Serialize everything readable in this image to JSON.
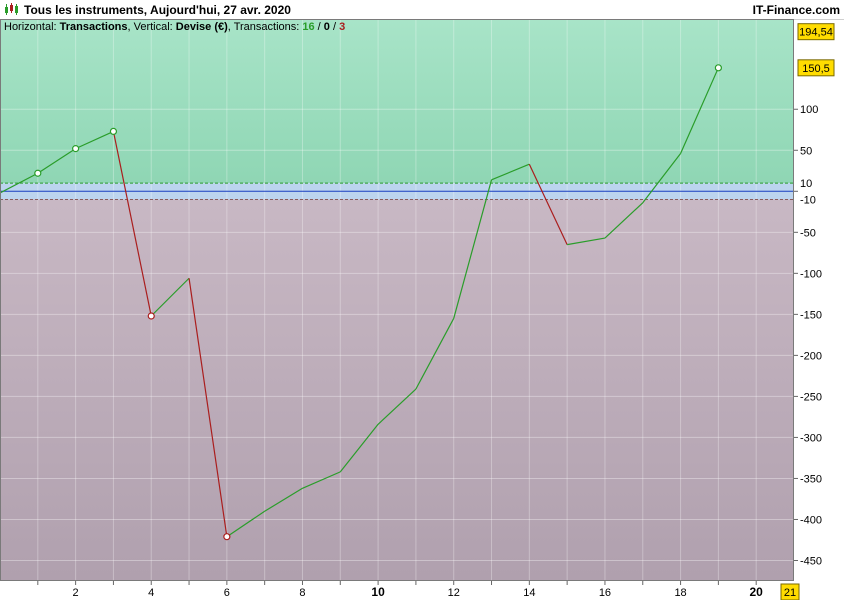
{
  "window": {
    "title": "Tous les instruments, Aujourd'hui, 27 avr. 2020",
    "brand": "IT-Finance.com"
  },
  "subtitle": {
    "h_prefix": "Horizontal: ",
    "h_value": "Transactions",
    "v_prefix": ", Vertical: ",
    "v_value": "Devise (€)",
    "t_prefix": ", Transactions: ",
    "wins": "16",
    "sep1": " / ",
    "neutral": "0",
    "sep2": " / ",
    "losses": "3"
  },
  "colors": {
    "win": "#2a9d2a",
    "loss": "#aa1e1e",
    "neutral": "#1a3fbf",
    "zone_positive": "#a8e4c8",
    "zone_negative": "#c8b8c4",
    "zone_neutral": "#bcd4ee",
    "badge": "#ffdc00"
  },
  "chart_data": {
    "type": "line",
    "title": "",
    "xlabel": "Transactions",
    "ylabel": "Devise (€)",
    "xlim": [
      0,
      21
    ],
    "ylim": [
      -475,
      210
    ],
    "x": [
      0,
      1,
      2,
      3,
      4,
      5,
      6,
      7,
      8,
      9,
      10,
      11,
      12,
      13,
      14,
      15,
      16,
      17,
      18,
      19
    ],
    "y": [
      -2,
      22,
      52,
      73,
      -152,
      -106,
      -421,
      -390,
      -362,
      -342,
      -284,
      -241,
      -155,
      14,
      33,
      -65,
      -57,
      -14,
      46,
      150.5
    ],
    "results": [
      "",
      "win",
      "win",
      "win",
      "loss",
      "win",
      "loss",
      "win",
      "win",
      "win",
      "win",
      "win",
      "win",
      "win",
      "win",
      "loss",
      "win",
      "win",
      "win",
      "win"
    ],
    "markers": [
      1,
      2,
      3,
      4,
      6,
      19
    ],
    "neutral_band": [
      -10,
      10
    ],
    "x_ticks": [
      2,
      4,
      6,
      8,
      10,
      12,
      14,
      16,
      18,
      20
    ],
    "x_ticks_bold": [
      10,
      20
    ],
    "x_last_label": "21",
    "y_ticks": [
      100,
      50,
      0,
      -50,
      -100,
      -150,
      -200,
      -250,
      -300,
      -350,
      -400,
      -450
    ],
    "y_tick_labels": [
      "100",
      "50",
      "",
      "-50",
      "-100",
      "-150",
      "-200",
      "-250",
      "-300",
      "-350",
      "-400",
      "-450"
    ],
    "band_labels": {
      "upper": "10",
      "lower": "-10"
    },
    "badges": [
      {
        "value": 194.54,
        "label": "194,54"
      },
      {
        "value": 150.5,
        "label": "150,5"
      }
    ],
    "grid": true
  }
}
